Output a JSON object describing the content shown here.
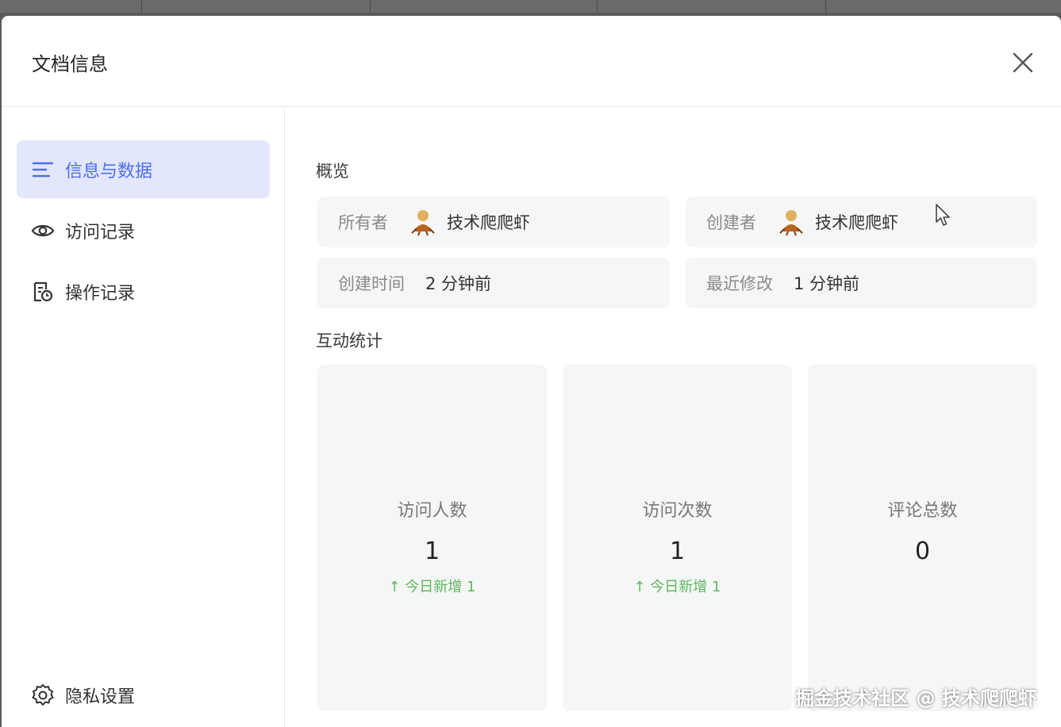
{
  "dialog": {
    "title": "文档信息"
  },
  "sidebar": {
    "items": [
      {
        "label": "信息与数据",
        "icon": "list-icon",
        "active": true
      },
      {
        "label": "访问记录",
        "icon": "eye-icon",
        "active": false
      },
      {
        "label": "操作记录",
        "icon": "document-clock-icon",
        "active": false
      }
    ],
    "bottom_item": {
      "label": "隐私设置",
      "icon": "gear-icon"
    }
  },
  "overview": {
    "title": "概览",
    "owner_label": "所有者",
    "owner_name": "技术爬爬虾",
    "creator_label": "创建者",
    "creator_name": "技术爬爬虾",
    "created_label": "创建时间",
    "created_value": "2 分钟前",
    "modified_label": "最近修改",
    "modified_value": "1 分钟前"
  },
  "stats": {
    "title": "互动统计",
    "cards": [
      {
        "label": "访问人数",
        "value": "1",
        "trend": "↑ 今日新增 1"
      },
      {
        "label": "访问次数",
        "value": "1",
        "trend": "↑ 今日新增 1"
      },
      {
        "label": "评论总数",
        "value": "0",
        "trend": ""
      }
    ]
  },
  "watermark": "掘金技术社区 @ 技术爬爬虾",
  "colors": {
    "accent": "#4e6ef2",
    "active_bg": "#e2e7fb",
    "trend_green": "#5cb85c",
    "card_bg": "#f5f6f6"
  }
}
